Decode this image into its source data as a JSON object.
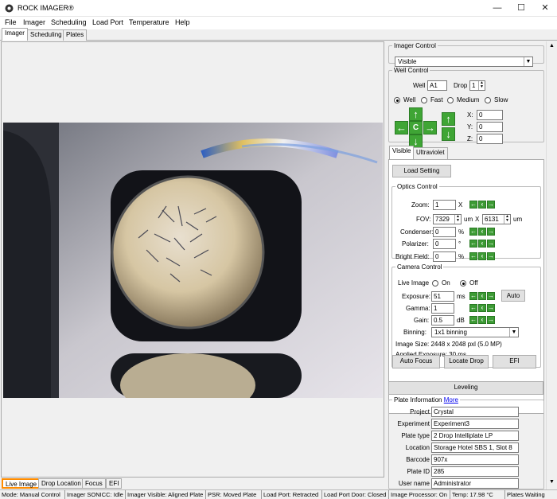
{
  "window": {
    "title": "ROCK IMAGER®",
    "minimize": "—",
    "maximize": "☐",
    "close": "✕"
  },
  "menu": [
    "File",
    "Imager",
    "Scheduling",
    "Load Port",
    "Temperature",
    "Help"
  ],
  "tabs": [
    "Imager",
    "Scheduling",
    "Plates"
  ],
  "imager_control": {
    "legend": "Imager Control",
    "mode": "Visible"
  },
  "well_control": {
    "legend": "Well Control",
    "well_label": "Well",
    "well_value": "A1",
    "drop_label": "Drop",
    "drop_value": "1",
    "modes": [
      "Well",
      "Fast",
      "Medium",
      "Slow"
    ],
    "selected_mode": "Well",
    "x_label": "X:",
    "x_value": "0",
    "y_label": "Y:",
    "y_value": "0",
    "z_label": "Z:",
    "z_value": "0",
    "center": "C"
  },
  "light_tabs": [
    "Visible",
    "Ultraviolet"
  ],
  "load_setting": "Load Setting",
  "optics": {
    "legend": "Optics Control",
    "zoom_label": "Zoom:",
    "zoom": "1",
    "zoom_unit": "X",
    "fov_label": "FOV:",
    "fov_w": "7329",
    "fov_h": "6131",
    "fov_unit": "um",
    "fov_x": "X",
    "condenser_label": "Condenser:",
    "condenser": "0",
    "condenser_unit": "%",
    "polarizer_label": "Polarizer:",
    "polarizer": "0",
    "polarizer_unit": "°",
    "bright_label": "Bright Field:",
    "bright": "0",
    "bright_unit": "%"
  },
  "camera": {
    "legend": "Camera Control",
    "live_label": "Live Image",
    "on": "On",
    "off": "Off",
    "live_state": "Off",
    "exposure_label": "Exposure:",
    "exposure": "51",
    "exposure_unit": "ms",
    "auto": "Auto",
    "gamma_label": "Gamma:",
    "gamma": "1",
    "gain_label": "Gain:",
    "gain": "0.5",
    "gain_unit": "dB",
    "binning_label": "Binning:",
    "binning": "1x1 binning",
    "image_size": "Image Size:  2448 x 2048 pxl (5.0 MP)",
    "applied_exposure": "Applied Exposure: 30 ms"
  },
  "actions": {
    "auto_focus": "Auto Focus",
    "locate_drop": "Locate Drop",
    "efi": "EFI"
  },
  "leveling": "Leveling",
  "plate_info": {
    "legend": "Plate Information",
    "more": "More",
    "rows": [
      {
        "label": "Project",
        "value": "Crystal"
      },
      {
        "label": "Experiment",
        "value": "Experiment3"
      },
      {
        "label": "Plate type",
        "value": "2 Drop Intelliplate LP"
      },
      {
        "label": "Location",
        "value": "Storage Hotel SBS 1, Slot 8"
      },
      {
        "label": "Barcode",
        "value": "907x"
      },
      {
        "label": "Plate ID",
        "value": "285"
      },
      {
        "label": "User name",
        "value": "Administrator"
      }
    ]
  },
  "bottom_tabs": [
    "Live Image",
    "Drop Location",
    "Focus",
    "EFI"
  ],
  "status": [
    "Mode: Manual Control",
    "Imager SONICC: Idle",
    "Imager Visible: Aligned Plate",
    "PSR: Moved Plate",
    "Load Port: Retracted",
    "Load Port Door: Closed",
    "Image Processor: On",
    "Temp: 17.98 °C",
    "Plates Waiting"
  ],
  "colors": {
    "accent_tab": "#ff8c00",
    "arrow_green": "#3fa535",
    "link": "#0000ee"
  }
}
